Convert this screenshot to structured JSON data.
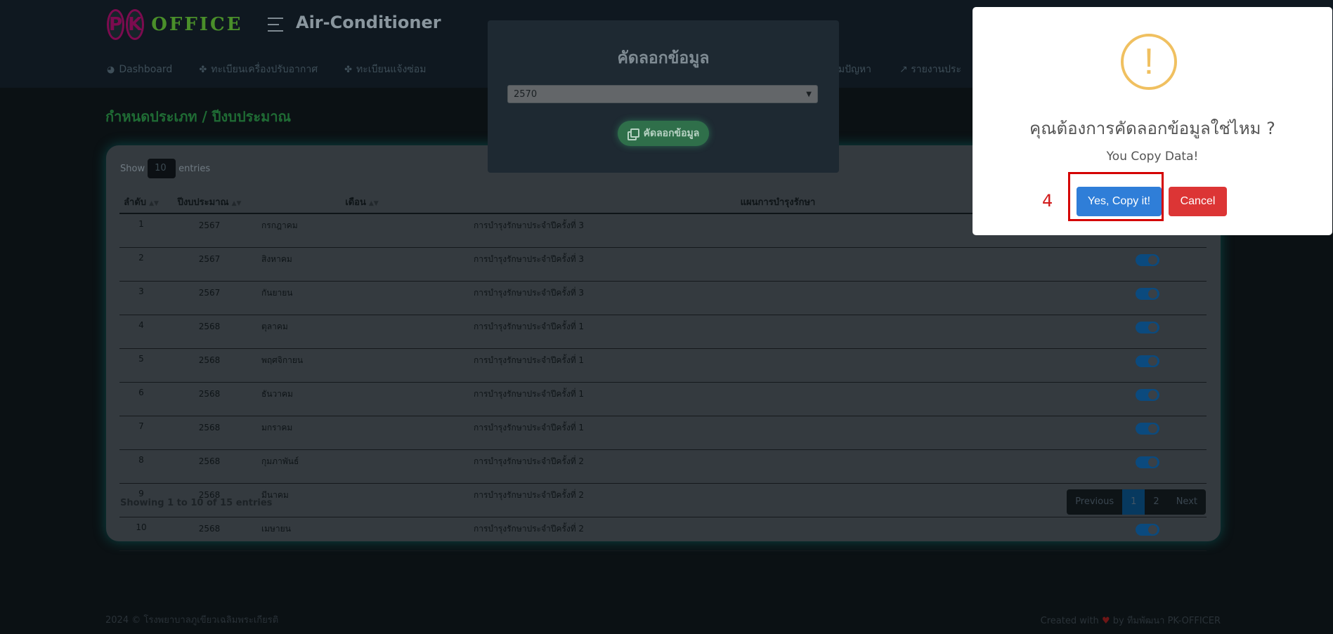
{
  "header": {
    "brand_mark_1": "P",
    "brand_mark_2": "K",
    "brand_text": "OFFICE",
    "app_title": "Air-Conditioner",
    "nav": [
      {
        "label": "Dashboard",
        "icon": "chart-pie-icon"
      },
      {
        "label": "ทะเบียนเครื่องปรับอากาศ",
        "icon": "fan-icon"
      },
      {
        "label": "ทะเบียนแจ้งซ่อม",
        "icon": "fan-icon"
      }
    ],
    "nav_partial": [
      "ามปัญหา",
      "รายงานประ"
    ]
  },
  "page": {
    "section_title": "กำหนดประเภท / ปีงบประมาณ"
  },
  "table": {
    "show_label": "Show",
    "entries_value": "10",
    "entries_label": "entries",
    "columns": [
      "ลำดับ",
      "ปีงบประมาณ",
      "เดือน",
      "แผนการบำรุงรักษา"
    ],
    "rows": [
      {
        "no": "1",
        "year": "2567",
        "month": "กรกฎาคม",
        "plan": "การบำรุงรักษาประจำปีครั้งที่ 3",
        "active": true
      },
      {
        "no": "2",
        "year": "2567",
        "month": "สิงหาคม",
        "plan": "การบำรุงรักษาประจำปีครั้งที่ 3",
        "active": true
      },
      {
        "no": "3",
        "year": "2567",
        "month": "กันยายน",
        "plan": "การบำรุงรักษาประจำปีครั้งที่ 3",
        "active": true
      },
      {
        "no": "4",
        "year": "2568",
        "month": "ตุลาคม",
        "plan": "การบำรุงรักษาประจำปีครั้งที่ 1",
        "active": true
      },
      {
        "no": "5",
        "year": "2568",
        "month": "พฤศจิกายน",
        "plan": "การบำรุงรักษาประจำปีครั้งที่ 1",
        "active": true
      },
      {
        "no": "6",
        "year": "2568",
        "month": "ธันวาคม",
        "plan": "การบำรุงรักษาประจำปีครั้งที่ 1",
        "active": true
      },
      {
        "no": "7",
        "year": "2568",
        "month": "มกราคม",
        "plan": "การบำรุงรักษาประจำปีครั้งที่ 1",
        "active": true
      },
      {
        "no": "8",
        "year": "2568",
        "month": "กุมภาพันธ์",
        "plan": "การบำรุงรักษาประจำปีครั้งที่ 2",
        "active": true
      },
      {
        "no": "9",
        "year": "2568",
        "month": "มีนาคม",
        "plan": "การบำรุงรักษาประจำปีครั้งที่ 2",
        "active": true
      },
      {
        "no": "10",
        "year": "2568",
        "month": "เมษายน",
        "plan": "การบำรุงรักษาประจำปีครั้งที่ 2",
        "active": true
      }
    ],
    "showing_text": "Showing 1 to 10 of 15 entries",
    "pagination": {
      "previous": "Previous",
      "pages": [
        "1",
        "2"
      ],
      "next": "Next",
      "current": "1"
    }
  },
  "footer": {
    "left": "2024 © โรงพยาบาลภูเขียวเฉลิมพระเกียรติ",
    "right_prefix": "Created with",
    "right_suffix": "by ทีมพัฒนา PK-OFFICER"
  },
  "copy_modal": {
    "title": "คัดลอกข้อมูล",
    "selected_year": "2570",
    "button_label": "คัดลอกข้อมูล"
  },
  "confirm_dialog": {
    "icon": "!",
    "title": "คุณต้องการคัดลอกข้อมูลใช่ไหม ?",
    "text": "You Copy Data!",
    "step_number": "4",
    "confirm_label": "Yes, Copy it!",
    "cancel_label": "Cancel"
  },
  "colors": {
    "confirm_button": "#2f7ed8",
    "cancel_button": "#dc3535",
    "warning_icon": "#f0c060",
    "highlight_box": "#d40000"
  }
}
